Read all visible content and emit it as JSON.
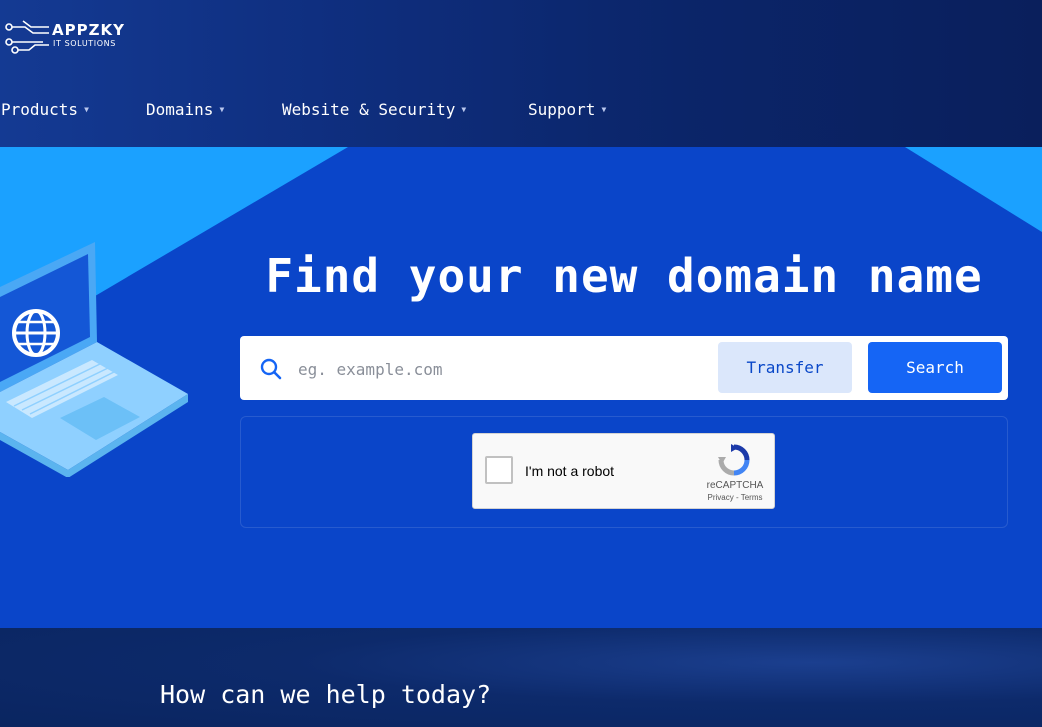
{
  "logo": {
    "name": "APPZKY",
    "tagline": "IT SOLUTIONS"
  },
  "nav": {
    "items": [
      {
        "label": "Products"
      },
      {
        "label": "Domains"
      },
      {
        "label": "Website & Security"
      },
      {
        "label": "Support"
      }
    ]
  },
  "hero": {
    "title": "Find your new domain name",
    "search": {
      "placeholder": "eg. example.com",
      "value": ""
    },
    "transfer_label": "Transfer",
    "search_label": "Search"
  },
  "captcha": {
    "label": "I'm not a robot",
    "brand": "reCAPTCHA",
    "privacy": "Privacy",
    "separator": " - ",
    "terms": "Terms",
    "checked": false
  },
  "help": {
    "title": "How can we help today?"
  },
  "colors": {
    "header_bg": "#0f2f80",
    "hero_bg": "#0a45c9",
    "accent_light_blue": "#16a0ff",
    "search_button": "#1565f5",
    "transfer_button": "#dbe7fb",
    "transfer_text": "#0a48c8"
  }
}
